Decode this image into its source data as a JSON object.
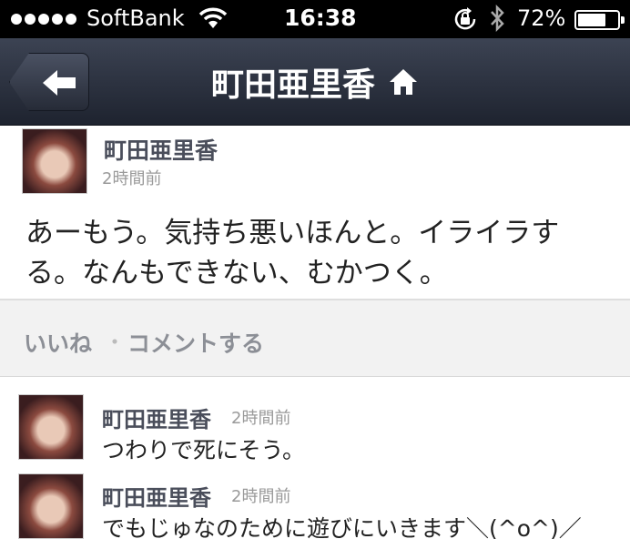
{
  "status_bar": {
    "carrier": "SoftBank",
    "time": "16:38",
    "battery_percent_text": "72%",
    "battery_level": 0.72,
    "icons": [
      "signal-dots-icon",
      "wifi-icon",
      "rotation-lock-icon",
      "bluetooth-icon",
      "battery-icon"
    ]
  },
  "nav": {
    "title": "町田亜里香",
    "back_icon": "back-arrow-icon",
    "home_icon": "home-icon"
  },
  "post": {
    "author": "町田亜里香",
    "time": "2時間前",
    "body": "あーもう。気持ち悪いほんと。イライラする。なんもできない、むかつく。"
  },
  "actions": {
    "like_label": "いいね",
    "separator": "・",
    "comment_label": "コメントする"
  },
  "comments": [
    {
      "author": "町田亜里香",
      "time": "2時間前",
      "text": "つわりで死にそう。"
    },
    {
      "author": "町田亜里香",
      "time": "2時間前",
      "text": "でもじゅなのために遊びにいきます＼(^o^)／"
    }
  ],
  "colors": {
    "nav_bg": "#2b303d",
    "name_text": "#4a4e5b",
    "meta_text": "#9a9a9a",
    "action_text": "#8c8f96",
    "action_bg": "#f2f2f2"
  }
}
